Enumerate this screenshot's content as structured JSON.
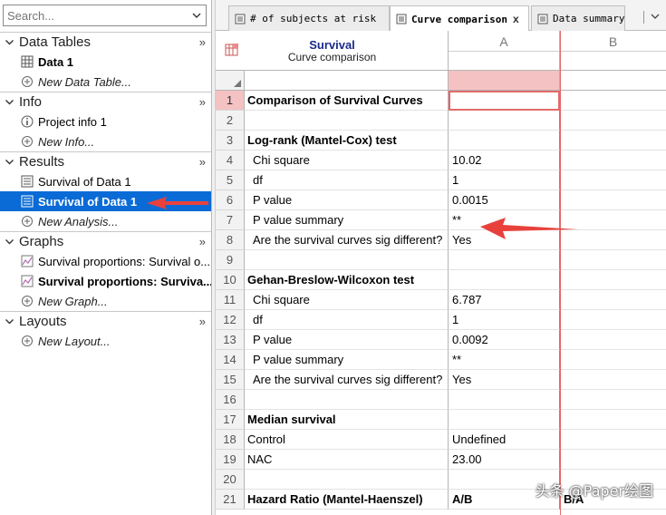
{
  "search": {
    "placeholder": "Search..."
  },
  "navigator": {
    "sections": [
      {
        "title": "Data Tables",
        "more": "»",
        "items": [
          {
            "label": "Data 1",
            "style": "bold",
            "icon": "data-table-icon"
          },
          {
            "label": "New Data Table...",
            "style": "italic",
            "icon": "add-icon"
          }
        ]
      },
      {
        "title": "Info",
        "more": "»",
        "items": [
          {
            "label": "Project info 1",
            "style": "normal",
            "icon": "info-icon"
          },
          {
            "label": "New Info...",
            "style": "italic",
            "icon": "add-icon"
          }
        ]
      },
      {
        "title": "Results",
        "more": "»",
        "items": [
          {
            "label": "Survival of Data 1",
            "style": "normal",
            "icon": "results-sheet-icon"
          },
          {
            "label": "Survival of Data 1",
            "style": "selected",
            "icon": "results-sheet-icon"
          },
          {
            "label": "New Analysis...",
            "style": "italic",
            "icon": "add-icon"
          }
        ]
      },
      {
        "title": "Graphs",
        "more": "»",
        "items": [
          {
            "label": "Survival proportions: Survival o...",
            "style": "normal",
            "icon": "graph-icon"
          },
          {
            "label": "Survival proportions: Surviva...",
            "style": "bold",
            "icon": "graph-icon"
          },
          {
            "label": "New Graph...",
            "style": "italic",
            "icon": "add-icon"
          }
        ]
      },
      {
        "title": "Layouts",
        "more": "»",
        "items": [
          {
            "label": "New Layout...",
            "style": "italic",
            "icon": "add-icon"
          }
        ]
      }
    ]
  },
  "tabs": [
    {
      "label": "# of subjects at risk",
      "active": false
    },
    {
      "label": "Curve comparison",
      "active": true,
      "close": "x"
    },
    {
      "label": "Data summary",
      "active": false
    }
  ],
  "sheet": {
    "corner_title": "Survival",
    "corner_subtitle": "Curve comparison",
    "col_a": "A",
    "col_b": "B",
    "rows": [
      {
        "n": "1",
        "label": "Comparison of Survival Curves",
        "bold": true,
        "a": "",
        "b": ""
      },
      {
        "n": "2",
        "label": "",
        "a": "",
        "b": ""
      },
      {
        "n": "3",
        "label": "Log-rank (Mantel-Cox) test",
        "bold": true,
        "a": "",
        "b": ""
      },
      {
        "n": "4",
        "label": "Chi square",
        "indent": true,
        "a": "10.02",
        "b": ""
      },
      {
        "n": "5",
        "label": "df",
        "indent": true,
        "a": "1",
        "b": ""
      },
      {
        "n": "6",
        "label": "P value",
        "indent": true,
        "a": "0.0015",
        "b": ""
      },
      {
        "n": "7",
        "label": "P value summary",
        "indent": true,
        "a": "**",
        "b": ""
      },
      {
        "n": "8",
        "label": "Are the survival curves sig different?",
        "indent": true,
        "a": "Yes",
        "b": ""
      },
      {
        "n": "9",
        "label": "",
        "a": "",
        "b": ""
      },
      {
        "n": "10",
        "label": "Gehan-Breslow-Wilcoxon test",
        "bold": true,
        "a": "",
        "b": ""
      },
      {
        "n": "11",
        "label": "Chi square",
        "indent": true,
        "a": "6.787",
        "b": ""
      },
      {
        "n": "12",
        "label": "df",
        "indent": true,
        "a": "1",
        "b": ""
      },
      {
        "n": "13",
        "label": "P value",
        "indent": true,
        "a": "0.0092",
        "b": ""
      },
      {
        "n": "14",
        "label": "P value summary",
        "indent": true,
        "a": "**",
        "b": ""
      },
      {
        "n": "15",
        "label": "Are the survival curves sig different?",
        "indent": true,
        "a": "Yes",
        "b": ""
      },
      {
        "n": "16",
        "label": "",
        "a": "",
        "b": ""
      },
      {
        "n": "17",
        "label": "Median survival",
        "bold": true,
        "a": "",
        "b": ""
      },
      {
        "n": "18",
        "label": "Control",
        "a": "Undefined",
        "b": ""
      },
      {
        "n": "19",
        "label": "NAC",
        "a": "23.00",
        "b": ""
      },
      {
        "n": "20",
        "label": "",
        "a": "",
        "b": ""
      },
      {
        "n": "21",
        "label": "Hazard Ratio (Mantel-Haenszel)",
        "bold": true,
        "a": "A/B",
        "b": "B/A",
        "abold": true,
        "bbold": true
      }
    ]
  },
  "watermark": "头条 @Paper绘图",
  "colors": {
    "selection": "#0a6bd6",
    "accent_red": "#e36a6a",
    "corner_title": "#1a2a8a",
    "arrow": "#e8413c"
  }
}
